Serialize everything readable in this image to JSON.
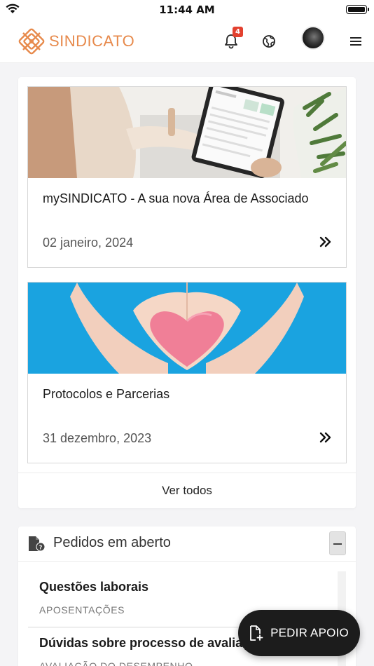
{
  "status_bar": {
    "time": "11:44 AM"
  },
  "header": {
    "logo_text": "SINDICATO",
    "notifications_count": "4",
    "brand_color": "#e78a4c",
    "icons": [
      "bell-icon",
      "globe-icon",
      "avatar",
      "menu-icon"
    ]
  },
  "news": {
    "items": [
      {
        "title": "mySINDICATO - A sua nova Área de Associado",
        "date": "02 janeiro, 2024",
        "image": "tablet-photo"
      },
      {
        "title": "Protocolos e Parcerias",
        "date": "31 dezembro, 2023",
        "image": "heart-hands-photo"
      }
    ],
    "see_all_label": "Ver todos"
  },
  "pedidos": {
    "title": "Pedidos em aberto",
    "items": [
      {
        "name": "Questões laborais",
        "category": "APOSENTAÇÕES"
      },
      {
        "name": "Dúvidas sobre processo de avaliação",
        "category": "AVALIAÇÃO DO DESEMPENHO"
      }
    ]
  },
  "fab": {
    "label": "PEDIR APOIO"
  }
}
